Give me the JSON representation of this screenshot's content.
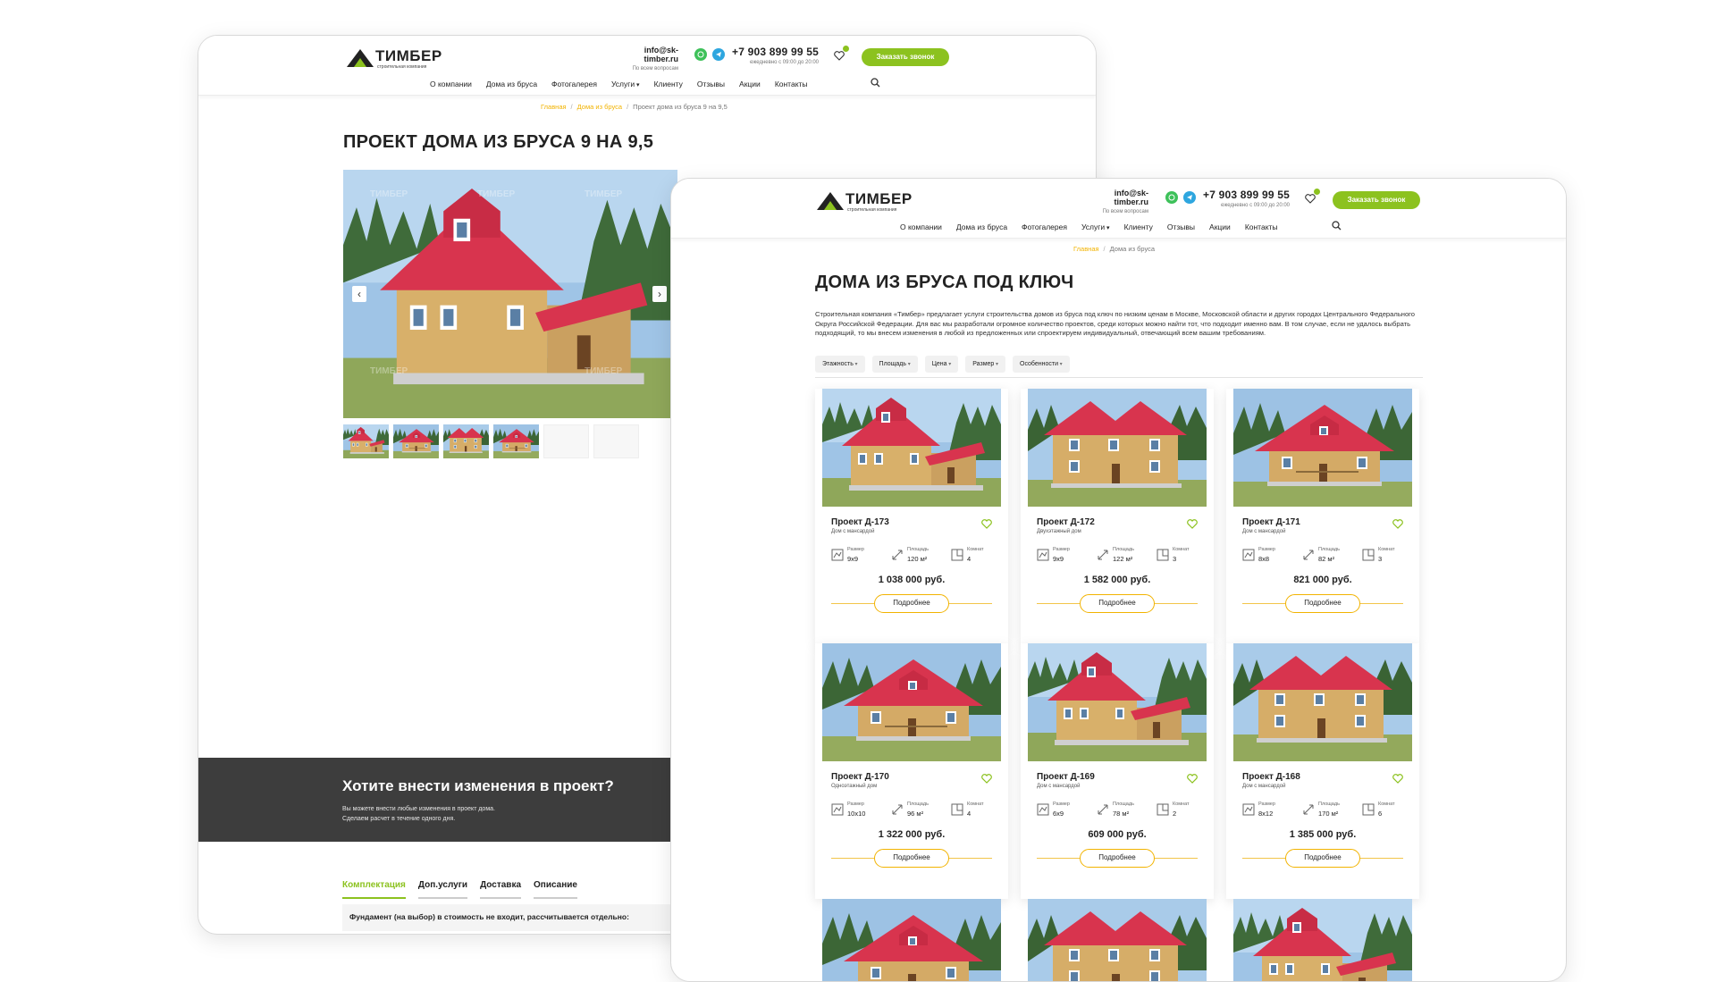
{
  "brand": {
    "name": "ТИМБЕР",
    "tagline": "строительная компания",
    "accent": "#8cc21f",
    "link_color": "#f2b300",
    "roof_color": "#d8344e"
  },
  "header": {
    "email": "info@sk-timber.ru",
    "email_sub": "По всем вопросам",
    "phone": "+7 903 899 99 55",
    "phone_sub": "ежедневно с 09:00 до 20:00",
    "callback_button": "Заказать звонок",
    "nav": [
      "О компании",
      "Дома из бруса",
      "Фотогалерея",
      "Услуги",
      "Клиенту",
      "Отзывы",
      "Акции",
      "Контакты"
    ],
    "icons": [
      "whatsapp-icon",
      "telegram-icon",
      "heart-icon",
      "search-icon"
    ]
  },
  "back_page": {
    "breadcrumb": [
      "Главная",
      "Дома из бруса",
      "Проект дома из бруса 9 на 9,5"
    ],
    "title": "ПРОЕКТ ДОМА ИЗ БРУСА 9 НА 9,5",
    "watermark": "ТИМБЕР",
    "banner": {
      "title": "Хотите внести изменения в проект?",
      "line1": "Вы можете внести любые изменения в проект дома.",
      "line2": "Сделаем расчет в течение одного дня."
    },
    "tabs": [
      "Комплектация",
      "Доп.услуги",
      "Доставка",
      "Описание"
    ],
    "active_tab": "Комплектация",
    "spec_row": "Фундамент (на выбор) в стоимость не входит, рассчитывается отдельно:"
  },
  "front_page": {
    "breadcrumb": [
      "Главная",
      "Дома из бруса"
    ],
    "title": "ДОМА ИЗ БРУСА ПОД КЛЮЧ",
    "intro": "Строительная компания «Тимбер» предлагает услуги строительства домов из бруса под ключ по низким ценам в Москве, Московской области и других городах Центрального Федерального Округа Российской Федерации. Для вас мы разработали огромное количество проектов, среди которых можно найти тот, что подходит именно вам. В том случае, если не удалось выбрать подходящий, то мы внесем изменения в любой из предложенных или спроектируем индивидуальный, отвечающий всем вашим требованиям.",
    "filters": [
      "Этажность",
      "Площадь",
      "Цена",
      "Размер",
      "Особенности"
    ],
    "spec_labels": {
      "size": "Размер",
      "area": "Площадь",
      "rooms": "Комнат"
    },
    "more_label": "Подробнее",
    "cards": [
      {
        "title": "Проект Д-173",
        "subtitle": "Дом с мансардой",
        "size": "9x9",
        "area": "120 м²",
        "rooms": "4",
        "price": "1 038 000 руб."
      },
      {
        "title": "Проект Д-172",
        "subtitle": "Двухэтажный дом",
        "size": "9x9",
        "area": "122 м²",
        "rooms": "3",
        "price": "1 582 000 руб."
      },
      {
        "title": "Проект Д-171",
        "subtitle": "Дом с мансардой",
        "size": "8x8",
        "area": "82 м²",
        "rooms": "3",
        "price": "821 000 руб."
      },
      {
        "title": "Проект Д-170",
        "subtitle": "Одноэтажный дом",
        "size": "10x10",
        "area": "96 м²",
        "rooms": "4",
        "price": "1 322 000 руб."
      },
      {
        "title": "Проект Д-169",
        "subtitle": "Дом с мансардой",
        "size": "6x9",
        "area": "78 м²",
        "rooms": "2",
        "price": "609 000 руб."
      },
      {
        "title": "Проект Д-168",
        "subtitle": "Дом с мансардой",
        "size": "8x12",
        "area": "170 м²",
        "rooms": "6",
        "price": "1 385 000 руб."
      }
    ]
  }
}
